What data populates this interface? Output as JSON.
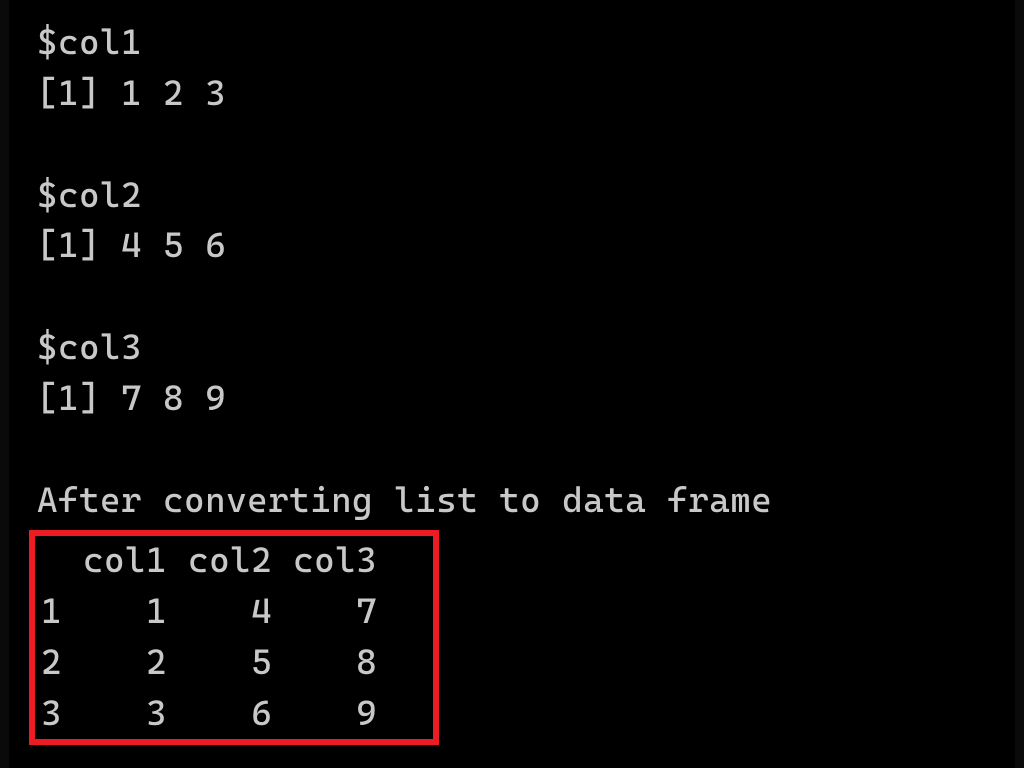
{
  "lines": {
    "col1_name": "$col1",
    "col1_values": "[1] 1 2 3",
    "col2_name": "$col2",
    "col2_values": "[1] 4 5 6",
    "col3_name": "$col3",
    "col3_values": "[1] 7 8 9",
    "message": "After converting list to data frame"
  },
  "dataframe": {
    "header": "  col1 col2 col3",
    "row1": "1    1    4    7",
    "row2": "2    2    5    8",
    "row3": "3    3    6    9"
  }
}
